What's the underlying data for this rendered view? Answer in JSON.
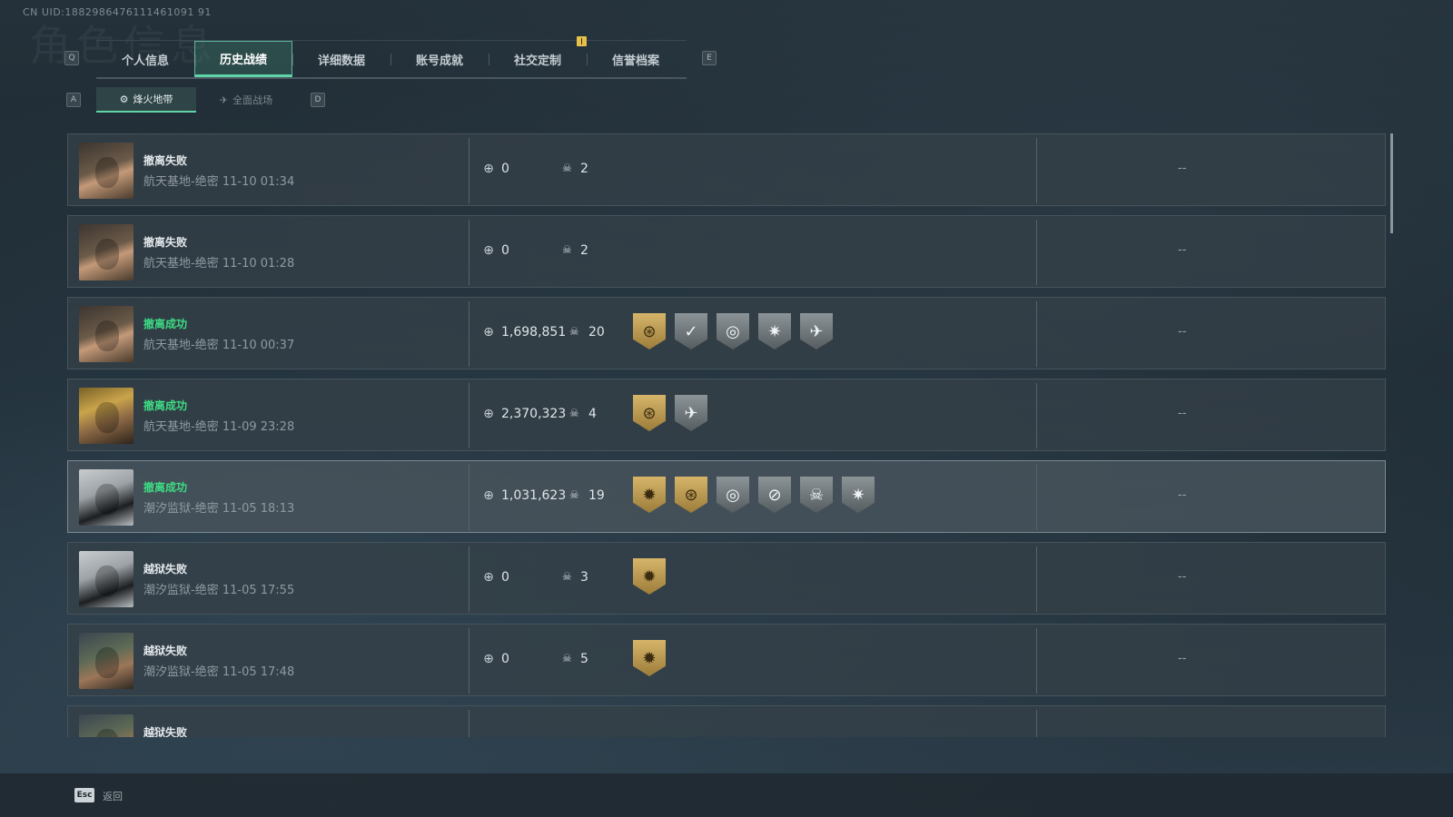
{
  "uid": "CN UID:1882986476111461091 91",
  "bg_title": "角色信息",
  "keyhints": {
    "q": "Q",
    "e": "E",
    "a": "A",
    "d": "D"
  },
  "tabs": [
    {
      "label": "个人信息"
    },
    {
      "label": "历史战绩",
      "active": true
    },
    {
      "label": "详细数据"
    },
    {
      "label": "账号成就"
    },
    {
      "label": "社交定制"
    },
    {
      "label": "信誉档案"
    }
  ],
  "subtabs": [
    {
      "label": "烽火地带",
      "icon": "⚙",
      "active": true
    },
    {
      "label": "全面战场",
      "icon": "✈"
    }
  ],
  "matches": [
    {
      "status": "撤离失败",
      "success": false,
      "map": "航天基地-绝密",
      "time": "11-10 01:34",
      "value": "0",
      "kills": "2",
      "avatar": "a1",
      "badges": [],
      "extra": "--"
    },
    {
      "status": "撤离失败",
      "success": false,
      "map": "航天基地-绝密",
      "time": "11-10 01:28",
      "value": "0",
      "kills": "2",
      "avatar": "a1",
      "badges": [],
      "extra": "--"
    },
    {
      "status": "撤离成功",
      "success": true,
      "map": "航天基地-绝密",
      "time": "11-10 00:37",
      "value": "1,698,851",
      "kills": "20",
      "avatar": "a1",
      "badges": [
        {
          "icon": "⊛",
          "color": "gold",
          "name": "target-medal"
        },
        {
          "icon": "✓",
          "color": "gray",
          "name": "shield-check-medal"
        },
        {
          "icon": "◎",
          "color": "gray",
          "name": "crosshair-medal"
        },
        {
          "icon": "✷",
          "color": "gray",
          "name": "star-burst-medal"
        },
        {
          "icon": "✈",
          "color": "gray",
          "name": "rocket-medal"
        }
      ],
      "extra": "--"
    },
    {
      "status": "撤离成功",
      "success": true,
      "map": "航天基地-绝密",
      "time": "11-09 23:28",
      "value": "2,370,323",
      "kills": "4",
      "avatar": "a2",
      "badges": [
        {
          "icon": "⊛",
          "color": "gold",
          "name": "target-medal"
        },
        {
          "icon": "✈",
          "color": "gray",
          "name": "rocket-medal"
        }
      ],
      "extra": "--"
    },
    {
      "status": "撤离成功",
      "success": true,
      "map": "潮汐监狱-绝密",
      "time": "11-05 18:13",
      "value": "1,031,623",
      "kills": "19",
      "avatar": "a3",
      "highlight": true,
      "badges": [
        {
          "icon": "✹",
          "color": "gold",
          "name": "sun-burst-medal"
        },
        {
          "icon": "⊛",
          "color": "gold",
          "name": "target-medal"
        },
        {
          "icon": "◎",
          "color": "gray",
          "name": "crosshair-medal"
        },
        {
          "icon": "⊘",
          "color": "gray",
          "name": "slash-crosshair-medal"
        },
        {
          "icon": "☠",
          "color": "gray",
          "name": "skull-target-medal"
        },
        {
          "icon": "✷",
          "color": "gray",
          "name": "star-burst-medal"
        }
      ],
      "extra": "--"
    },
    {
      "status": "越狱失败",
      "success": false,
      "map": "潮汐监狱-绝密",
      "time": "11-05 17:55",
      "value": "0",
      "kills": "3",
      "avatar": "a3",
      "badges": [
        {
          "icon": "✹",
          "color": "gold",
          "name": "sun-burst-medal"
        }
      ],
      "extra": "--"
    },
    {
      "status": "越狱失败",
      "success": false,
      "map": "潮汐监狱-绝密",
      "time": "11-05 17:48",
      "value": "0",
      "kills": "5",
      "avatar": "a4",
      "badges": [
        {
          "icon": "✹",
          "color": "gold",
          "name": "sun-burst-medal"
        }
      ],
      "extra": "--"
    },
    {
      "status": "越狱失败",
      "success": false,
      "map": "",
      "time": "",
      "value": "",
      "kills": "",
      "avatar": "a4",
      "badges": [],
      "extra": ""
    }
  ],
  "footer": {
    "esc_key": "Esc",
    "esc_label": "返回"
  },
  "colors": {
    "accent": "#5fd4a6",
    "success": "#3ddc84",
    "gold_medal": "#c9a553",
    "gray_medal": "#7b8387"
  }
}
